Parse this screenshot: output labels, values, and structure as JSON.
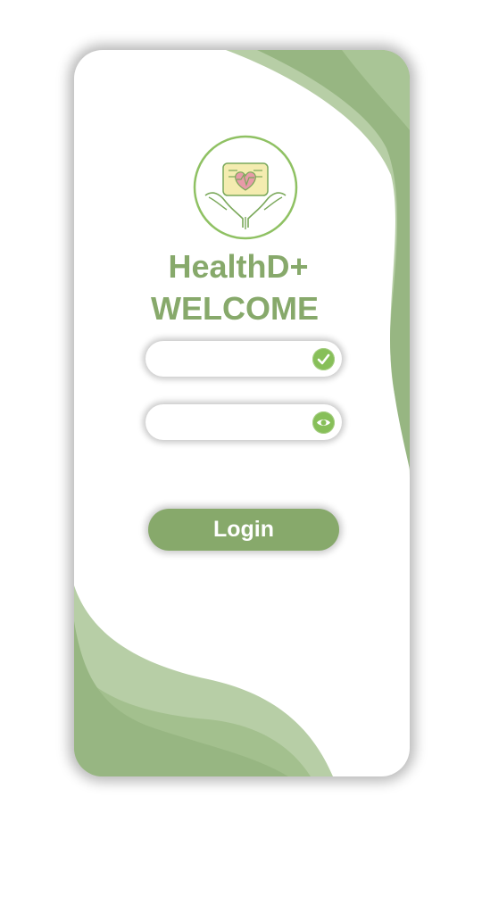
{
  "app": {
    "name": "HealthD+",
    "welcome": "WELCOME"
  },
  "form": {
    "username": {
      "value": "",
      "placeholder": "",
      "icon": "check-circle-icon"
    },
    "password": {
      "value": "",
      "placeholder": "",
      "icon": "eye-icon"
    },
    "login_label": "Login"
  },
  "colors": {
    "brand": "#87a96b",
    "wave_dark": "#97b682",
    "wave_light": "#b7cea6",
    "icon_green": "#87bf59"
  }
}
